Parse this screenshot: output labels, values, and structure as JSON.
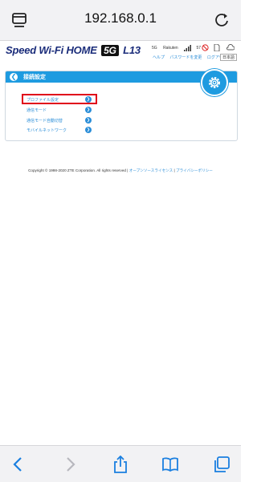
{
  "browser": {
    "url": "192.168.0.1"
  },
  "header": {
    "brand_main": "Speed Wi-Fi HOME",
    "brand_5g": "5G",
    "brand_model": "L13",
    "status": {
      "network": "5G",
      "carrier": "Rakuten",
      "signal_value": "57"
    },
    "links": [
      "ヘルプ",
      "パスワードを変更",
      "ログアウト"
    ],
    "language": "日本語"
  },
  "panel": {
    "title": "接続設定",
    "items": [
      {
        "label": "プロファイル設定"
      },
      {
        "label": "通信モード"
      },
      {
        "label": "通信モード自動切替"
      },
      {
        "label": "モバイルネットワーク"
      }
    ]
  },
  "footer": {
    "copyright": "Copyright © 1998-2020 ZTE Corporation. All rights reserved",
    "separator": "|",
    "link1": "オープンソースライセンス",
    "link2": "プライバシーポリシー"
  },
  "colors": {
    "accent": "#1e9be0",
    "link": "#2b8ed8",
    "highlight": "#e0001a",
    "brand": "#1a2c7a"
  }
}
